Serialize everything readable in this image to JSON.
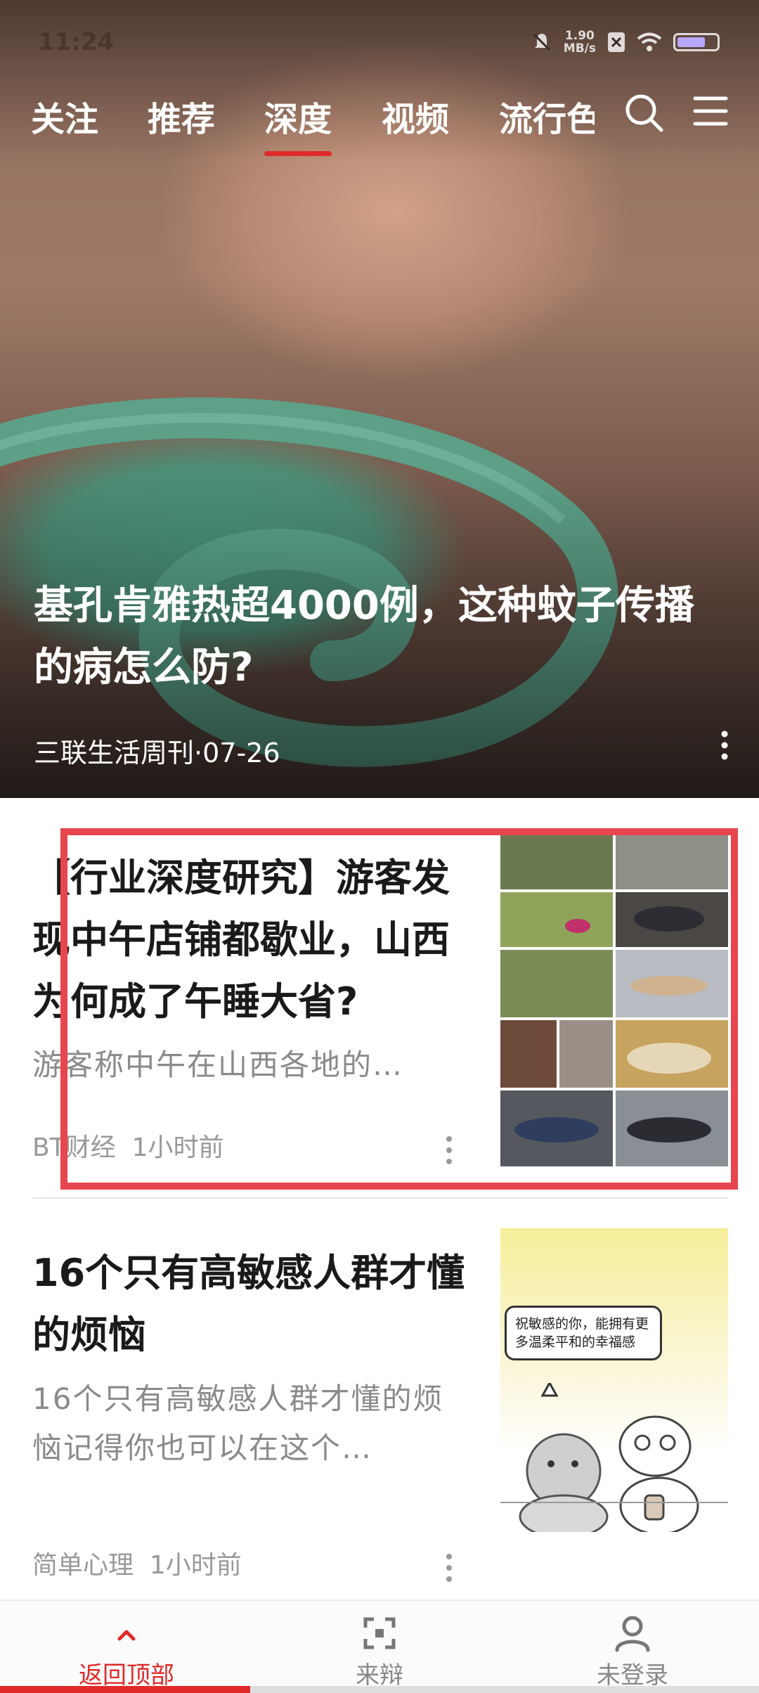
{
  "status_bar": {
    "time": "11:24",
    "net_speed_value": "1.90",
    "net_speed_unit": "MB/s"
  },
  "nav": {
    "tabs": [
      {
        "label": "关注"
      },
      {
        "label": "推荐"
      },
      {
        "label": "深度",
        "active": true
      },
      {
        "label": "视频"
      },
      {
        "label": "流行色"
      }
    ],
    "search_icon": "search-icon",
    "menu_icon": "menu-icon"
  },
  "hero": {
    "title": "基孔肯雅热超4000例，这种蚊子传播的病怎么防?",
    "source": "三联生活周刊",
    "date": "07-26"
  },
  "articles": [
    {
      "title": "【行业深度研究】游客发现中午店铺都歇业，山西为何成了午睡大省?",
      "summary": "游客称中午在山西各地的…",
      "source": "BT财经",
      "time": "1小时前"
    },
    {
      "title": "16个只有高敏感人群才懂的烦恼",
      "summary": "16个只有高敏感人群才懂的烦恼记得你也可以在这个…",
      "source": "简单心理",
      "time": "1小时前",
      "thumb_bubble": "祝敏感的你，能拥有更多温柔平和的幸福感"
    }
  ],
  "bottom_bar": {
    "items": [
      {
        "label": "返回顶部",
        "icon": "chevron-up-icon",
        "active": true
      },
      {
        "label": "来辩",
        "icon": "scan-frame-icon"
      },
      {
        "label": "未登录",
        "icon": "user-icon"
      }
    ]
  },
  "colors": {
    "accent": "#e02a2a",
    "highlight": "#e9454e"
  }
}
